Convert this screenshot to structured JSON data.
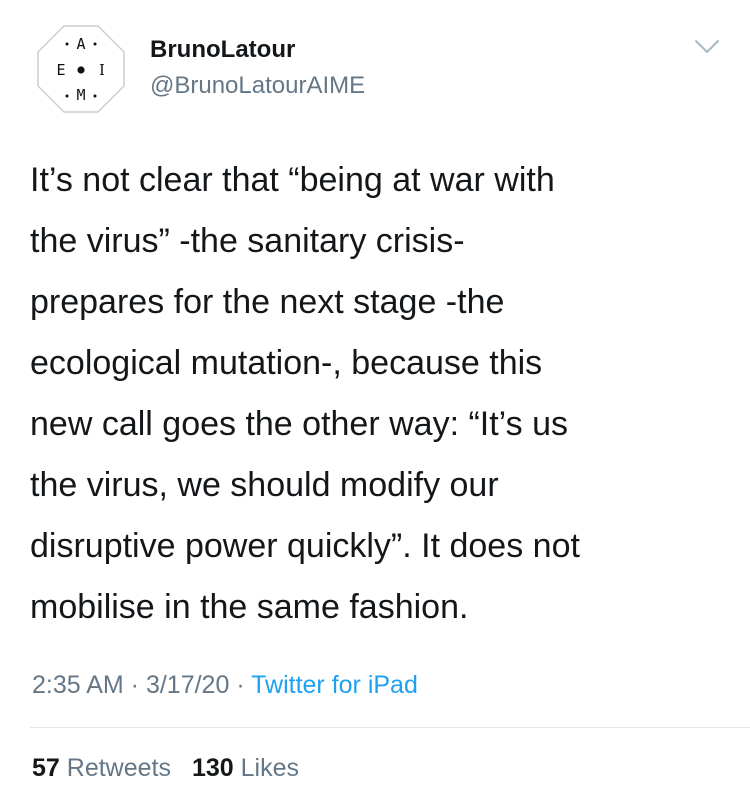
{
  "author": {
    "display_name": "BrunoLatour",
    "handle": "@BrunoLatourAIME",
    "avatar": {
      "letters": {
        "top": "A",
        "left": "E",
        "right": "I",
        "bottom": "M"
      }
    }
  },
  "menu": {
    "icon": "chevron-down-icon"
  },
  "tweet": {
    "lines": [
      "It’s not clear that “being at war with",
      "the virus” -the sanitary crisis-",
      "prepares for the next stage -the",
      "ecological mutation-, because this",
      "new call goes the other way: “It’s us",
      "the virus, we should modify our",
      "disruptive power quickly”. It does not",
      "mobilise in the same fashion."
    ]
  },
  "meta": {
    "time": "2:35 AM",
    "date": "3/17/20",
    "separator": " · ",
    "source": "Twitter for iPad"
  },
  "stats": {
    "retweets_count": "57",
    "retweets_label": "Retweets",
    "likes_count": "130",
    "likes_label": "Likes"
  },
  "colors": {
    "text": "#14171a",
    "secondary": "#657786",
    "link": "#1da1f2",
    "divider": "#e1e8ed"
  }
}
